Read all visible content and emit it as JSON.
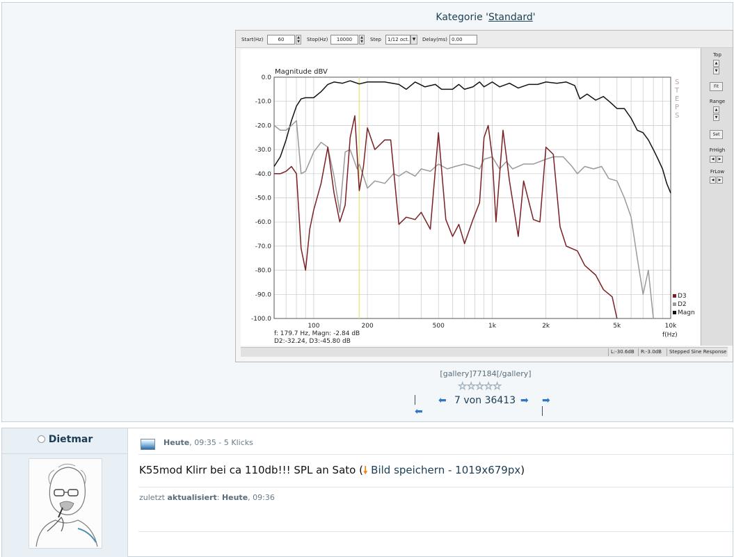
{
  "category": {
    "prefix": "Kategorie '",
    "name": "Standard",
    "suffix": "'"
  },
  "rew": {
    "toolbar": {
      "start_label": "Start(Hz)",
      "start_value": "60",
      "stop_label": "Stop(Hz)",
      "stop_value": "10000",
      "step_label": "Step",
      "step_value": "1/12 oct.",
      "delay_label": "Delay(ms)",
      "delay_value": "0.00"
    },
    "side": {
      "top": "Top",
      "fit": "Fit",
      "range": "Range",
      "set": "Set",
      "frhigh": "FrHigh",
      "frlow": "FrLow"
    },
    "status": {
      "left": "L:-30.6dB",
      "right": "R:-3.0dB",
      "mode": "Stepped Sine Response"
    }
  },
  "chart_data": {
    "type": "line",
    "title": "Magnitude dBV",
    "xlabel": "f(Hz)",
    "x_scale": "log",
    "xlim": [
      60,
      10000
    ],
    "ylim": [
      -100,
      0
    ],
    "yticks": [
      "0.0",
      "-10.0",
      "-20.0",
      "-30.0",
      "-40.0",
      "-50.0",
      "-60.0",
      "-70.0",
      "-80.0",
      "-90.0",
      "-100.0"
    ],
    "xticks": [
      {
        "f": 100,
        "label": "100"
      },
      {
        "f": 200,
        "label": "200"
      },
      {
        "f": 500,
        "label": "500"
      },
      {
        "f": 1000,
        "label": "1k"
      },
      {
        "f": 2000,
        "label": "2k"
      },
      {
        "f": 5000,
        "label": "5k"
      },
      {
        "f": 10000,
        "label": "10k"
      }
    ],
    "side_label": "STEPS",
    "grid": true,
    "legend_position": "bottom-right",
    "cursor": {
      "f": 179.7,
      "readout1": "f:  179.7 Hz, Magn: -2.84 dB",
      "readout2": "D2:-32.24, D3:-45.80 dB"
    },
    "series": [
      {
        "name": "Magn",
        "color": "#111111",
        "points": [
          [
            60,
            -37
          ],
          [
            65,
            -33
          ],
          [
            70,
            -26
          ],
          [
            75,
            -18
          ],
          [
            80,
            -12
          ],
          [
            85,
            -9
          ],
          [
            90,
            -8.5
          ],
          [
            100,
            -8.5
          ],
          [
            110,
            -6
          ],
          [
            120,
            -3
          ],
          [
            130,
            -2
          ],
          [
            145,
            -2.5
          ],
          [
            160,
            -1.5
          ],
          [
            180,
            -2.8
          ],
          [
            200,
            -2
          ],
          [
            250,
            -2
          ],
          [
            300,
            -3
          ],
          [
            330,
            -5
          ],
          [
            370,
            -2
          ],
          [
            420,
            -4
          ],
          [
            480,
            -3
          ],
          [
            520,
            -5
          ],
          [
            600,
            -5
          ],
          [
            650,
            -3
          ],
          [
            700,
            -5
          ],
          [
            780,
            -4
          ],
          [
            850,
            -2
          ],
          [
            900,
            -4
          ],
          [
            1000,
            -2
          ],
          [
            1100,
            -4
          ],
          [
            1250,
            -2.5
          ],
          [
            1400,
            -4.5
          ],
          [
            1600,
            -3
          ],
          [
            1800,
            -3
          ],
          [
            2000,
            -2
          ],
          [
            2300,
            -2.5
          ],
          [
            2600,
            -2
          ],
          [
            2900,
            -3.5
          ],
          [
            3100,
            -9
          ],
          [
            3400,
            -7
          ],
          [
            3800,
            -9.5
          ],
          [
            4200,
            -8
          ],
          [
            4600,
            -10.5
          ],
          [
            5000,
            -13
          ],
          [
            5500,
            -13
          ],
          [
            6000,
            -17
          ],
          [
            6500,
            -22
          ],
          [
            7000,
            -23
          ],
          [
            7500,
            -26
          ],
          [
            8000,
            -30
          ],
          [
            8500,
            -34
          ],
          [
            9000,
            -38
          ],
          [
            9500,
            -44
          ],
          [
            10000,
            -48
          ]
        ]
      },
      {
        "name": "D2",
        "color": "#999999",
        "points": [
          [
            60,
            -20
          ],
          [
            65,
            -22
          ],
          [
            70,
            -22
          ],
          [
            75,
            -20
          ],
          [
            80,
            -18
          ],
          [
            85,
            -40
          ],
          [
            90,
            -39
          ],
          [
            100,
            -31
          ],
          [
            110,
            -27
          ],
          [
            120,
            -29
          ],
          [
            130,
            -41
          ],
          [
            140,
            -56
          ],
          [
            150,
            -31
          ],
          [
            160,
            -30
          ],
          [
            175,
            -38
          ],
          [
            180,
            -36
          ],
          [
            190,
            -41
          ],
          [
            200,
            -46
          ],
          [
            220,
            -43
          ],
          [
            250,
            -44
          ],
          [
            280,
            -40
          ],
          [
            300,
            -41
          ],
          [
            330,
            -39
          ],
          [
            370,
            -41
          ],
          [
            400,
            -38
          ],
          [
            450,
            -39
          ],
          [
            500,
            -36
          ],
          [
            560,
            -38
          ],
          [
            620,
            -37
          ],
          [
            700,
            -36
          ],
          [
            780,
            -37
          ],
          [
            850,
            -38
          ],
          [
            900,
            -34
          ],
          [
            1000,
            -33
          ],
          [
            1100,
            -38
          ],
          [
            1200,
            -35
          ],
          [
            1300,
            -38
          ],
          [
            1500,
            -36
          ],
          [
            1700,
            -36
          ],
          [
            2000,
            -34
          ],
          [
            2200,
            -33
          ],
          [
            2500,
            -33
          ],
          [
            2800,
            -37
          ],
          [
            3000,
            -40
          ],
          [
            3300,
            -37
          ],
          [
            3700,
            -38
          ],
          [
            4100,
            -37
          ],
          [
            4500,
            -42
          ],
          [
            5000,
            -43
          ],
          [
            5500,
            -50
          ],
          [
            6000,
            -58
          ],
          [
            6500,
            -75
          ],
          [
            7000,
            -90
          ],
          [
            7500,
            -80
          ],
          [
            8000,
            -100
          ]
        ]
      },
      {
        "name": "D3",
        "color": "#7a1f22",
        "points": [
          [
            60,
            -40
          ],
          [
            65,
            -40
          ],
          [
            70,
            -39
          ],
          [
            75,
            -37
          ],
          [
            80,
            -40
          ],
          [
            85,
            -71
          ],
          [
            90,
            -80
          ],
          [
            95,
            -63
          ],
          [
            100,
            -55
          ],
          [
            110,
            -44
          ],
          [
            120,
            -29
          ],
          [
            130,
            -48
          ],
          [
            140,
            -60
          ],
          [
            150,
            -53
          ],
          [
            160,
            -25
          ],
          [
            170,
            -16
          ],
          [
            180,
            -47
          ],
          [
            190,
            -37
          ],
          [
            200,
            -21
          ],
          [
            220,
            -30
          ],
          [
            250,
            -26
          ],
          [
            270,
            -26
          ],
          [
            300,
            -61
          ],
          [
            330,
            -58
          ],
          [
            370,
            -59
          ],
          [
            400,
            -56
          ],
          [
            450,
            -63
          ],
          [
            500,
            -23
          ],
          [
            550,
            -59
          ],
          [
            600,
            -66
          ],
          [
            650,
            -61
          ],
          [
            700,
            -69
          ],
          [
            780,
            -59
          ],
          [
            850,
            -52
          ],
          [
            900,
            -25
          ],
          [
            950,
            -20
          ],
          [
            1000,
            -33
          ],
          [
            1050,
            -60
          ],
          [
            1150,
            -22
          ],
          [
            1250,
            -43
          ],
          [
            1400,
            -66
          ],
          [
            1500,
            -43
          ],
          [
            1700,
            -59
          ],
          [
            1850,
            -60
          ],
          [
            2000,
            -29
          ],
          [
            2200,
            -32
          ],
          [
            2400,
            -62
          ],
          [
            2600,
            -70
          ],
          [
            3000,
            -72
          ],
          [
            3300,
            -78
          ],
          [
            3800,
            -82
          ],
          [
            4200,
            -88
          ],
          [
            4700,
            -91
          ],
          [
            5000,
            -100
          ]
        ]
      }
    ]
  },
  "gallery": {
    "tag": "[gallery]77184[/gallery]",
    "rating_stars": 5,
    "pager": {
      "current": "7",
      "von": "von",
      "total": "36413"
    }
  },
  "post": {
    "author": "Dietmar",
    "meta_date": "Heute",
    "meta_rest": ", 09:35 - 5 Klicks",
    "title": "K55mod Klirr bei ca 110db!!! SPL an Sato (",
    "save_label": "Bild speichern - 1019x679px",
    "title_end": ")",
    "updated_prefix": "zuletzt ",
    "updated_bold": "aktualisiert",
    "updated_sep": ": ",
    "updated_date": "Heute",
    "updated_time": ", 09:36"
  },
  "icons": {
    "online": "status-circle-icon",
    "image": "image-icon",
    "save": "download-arrow-icon"
  }
}
